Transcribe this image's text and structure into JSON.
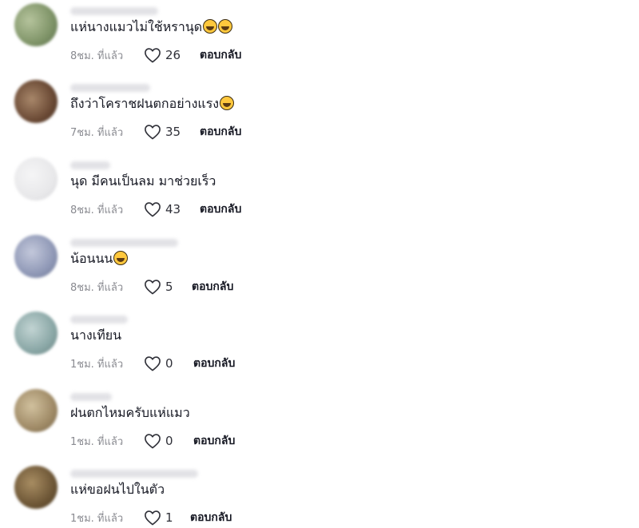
{
  "comments": [
    {
      "text": "แห่นางแมวไม่ใช้หรานุด",
      "emojis": 2,
      "time": "8ชม. ที่แล้ว",
      "likes": "26",
      "reply": "ตอบกลับ",
      "avatar_color": "#7f9468",
      "username_width": 110
    },
    {
      "text": "ถึงว่าโคราชฝนตกอย่างแรง",
      "emojis": 1,
      "time": "7ชม. ที่แล้ว",
      "likes": "35",
      "reply": "ตอบกลับ",
      "avatar_color": "#6b4a35",
      "username_width": 100
    },
    {
      "text": "นุด มีคนเป็นลม มาช่วยเร็ว",
      "emojis": 0,
      "time": "8ชม. ที่แล้ว",
      "likes": "43",
      "reply": "ตอบกลับ",
      "avatar_color": "#e8e8ea",
      "username_width": 50
    },
    {
      "text": "น้อนนน",
      "emojis": 1,
      "time": "8ชม. ที่แล้ว",
      "likes": "5",
      "reply": "ตอบกลับ",
      "avatar_color": "#8f98b6",
      "username_width": 135
    },
    {
      "text": "นางเทียน",
      "emojis": 0,
      "time": "1ชม. ที่แล้ว",
      "likes": "0",
      "reply": "ตอบกลับ",
      "avatar_color": "#8aa7a6",
      "username_width": 72
    },
    {
      "text": "ฝนตกไหมครับแห่แมว",
      "emojis": 0,
      "time": "1ชม. ที่แล้ว",
      "likes": "0",
      "reply": "ตอบกลับ",
      "avatar_color": "#9f8a66",
      "username_width": 52
    },
    {
      "text": "แห่ขอฝนไปในตัว",
      "emojis": 0,
      "time": "1ชม. ที่แล้ว",
      "likes": "1",
      "reply": "ตอบกลับ",
      "avatar_color": "#6d5636",
      "username_width": 160
    }
  ]
}
